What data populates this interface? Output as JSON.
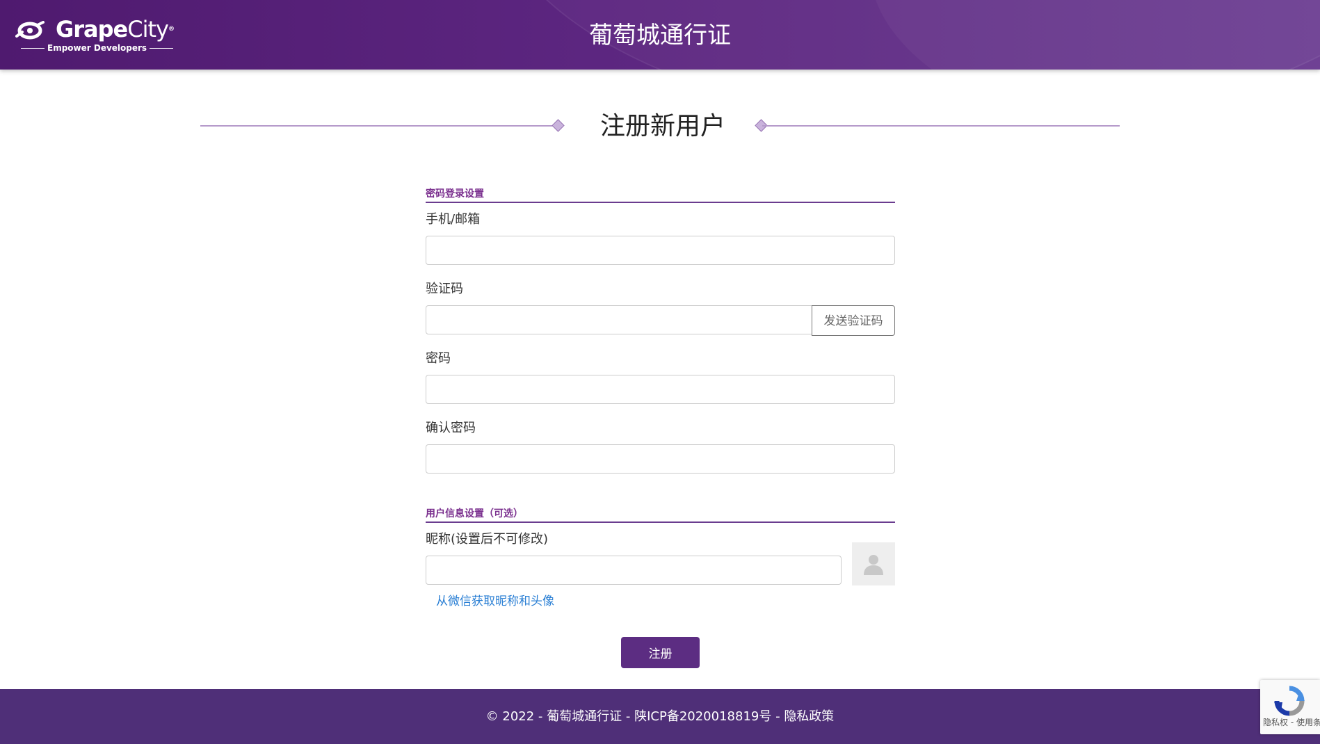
{
  "header": {
    "logo_brand_bold": "Grape",
    "logo_brand_light": "City",
    "logo_reg": "®",
    "logo_tagline": "Empower Developers",
    "title": "葡萄城通行证"
  },
  "page": {
    "title": "注册新用户"
  },
  "form": {
    "section_login": "密码登录设置",
    "phone_email_label": "手机/邮箱",
    "phone_email_value": "",
    "code_label": "验证码",
    "code_value": "",
    "send_code_label": "发送验证码",
    "password_label": "密码",
    "password_value": "",
    "confirm_password_label": "确认密码",
    "confirm_password_value": "",
    "section_profile": "用户信息设置（可选）",
    "nickname_label": "昵称(设置后不可修改)",
    "nickname_value": "",
    "wechat_link": "从微信获取昵称和头像",
    "register_label": "注册"
  },
  "footer": {
    "copyright": "© 2022 - 葡萄城通行证 - ",
    "icp": "陕ICP备2020018819号",
    "sep": " - ",
    "privacy": "隐私政策"
  },
  "recaptcha": {
    "text": "隐私权 - 使用条款"
  },
  "colors": {
    "brand_purple": "#5c2d82",
    "link_blue": "#2a7fd4",
    "section_purple": "#7a2f8e"
  }
}
